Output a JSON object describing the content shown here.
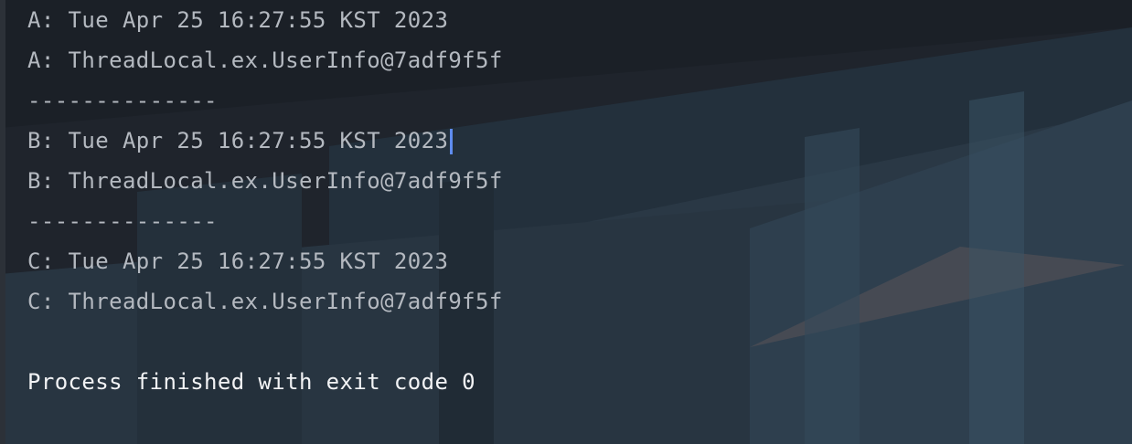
{
  "console": {
    "lines": [
      "A: Tue Apr 25 16:27:55 KST 2023",
      "A: ThreadLocal.ex.UserInfo@7adf9f5f",
      "--------------",
      "B: Tue Apr 25 16:27:55 KST 2023",
      "B: ThreadLocal.ex.UserInfo@7adf9f5f",
      "--------------",
      "C: Tue Apr 25 16:27:55 KST 2023",
      "C: ThreadLocal.ex.UserInfo@7adf9f5f"
    ],
    "final_message": "Process finished with exit code 0"
  },
  "colors": {
    "background": "#1f242c",
    "text": "#b4b9c0",
    "final_text": "#f2f3f5",
    "caret": "#5f8cf0"
  }
}
